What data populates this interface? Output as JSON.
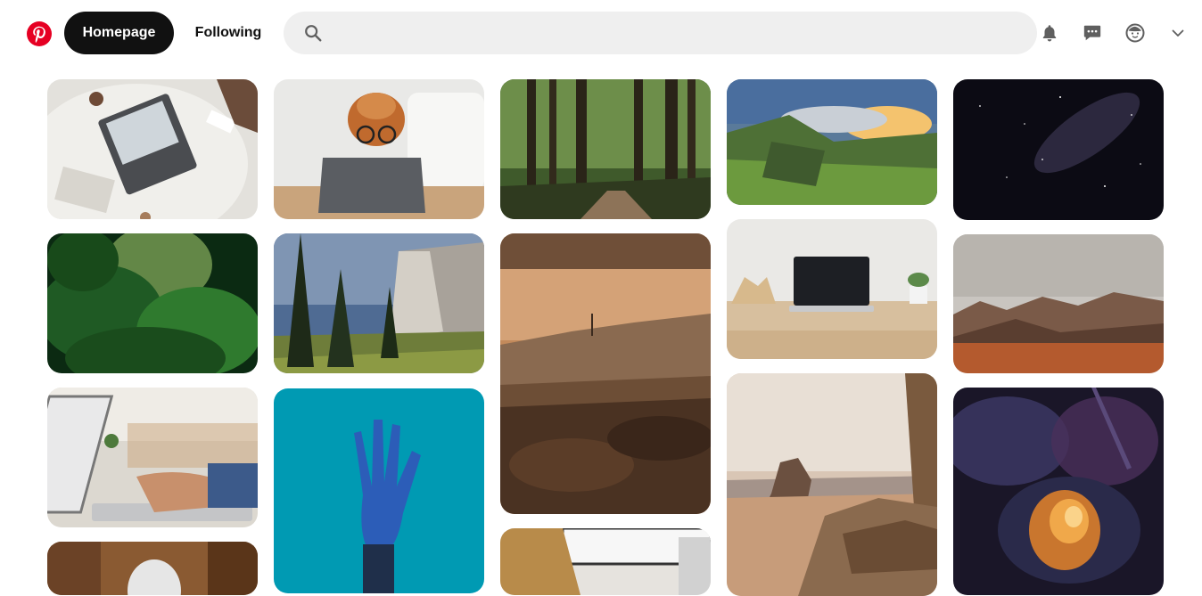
{
  "header": {
    "logo_icon": "pinterest-logo-icon",
    "brand_color": "#e60023",
    "nav": {
      "home_label": "Homepage",
      "following_label": "Following"
    },
    "search": {
      "placeholder": "",
      "value": ""
    },
    "icons": [
      "bell-icon",
      "message-icon",
      "avatar-icon",
      "chevron-down-icon"
    ]
  },
  "feed": {
    "pins": [
      {
        "subject": "laptop-desk-topview"
      },
      {
        "subject": "dog-with-glasses-tablet"
      },
      {
        "subject": "forest-path"
      },
      {
        "subject": "mountain-valley-sunrise"
      },
      {
        "subject": "starry-night-sky"
      },
      {
        "subject": "jungle-canopy"
      },
      {
        "subject": "mountain-cliff-pines"
      },
      {
        "subject": "desert-hills-sunset"
      },
      {
        "subject": "laptop-on-wood-table"
      },
      {
        "subject": "desert-rock-formations"
      },
      {
        "subject": "hands-typing-laptop"
      },
      {
        "subject": "robotic-hand-blue"
      },
      {
        "subject": "canyon-rock-desert"
      },
      {
        "subject": "nebula-space"
      },
      {
        "subject": "robot-interior"
      },
      {
        "subject": "person-laptop-window"
      }
    ]
  }
}
